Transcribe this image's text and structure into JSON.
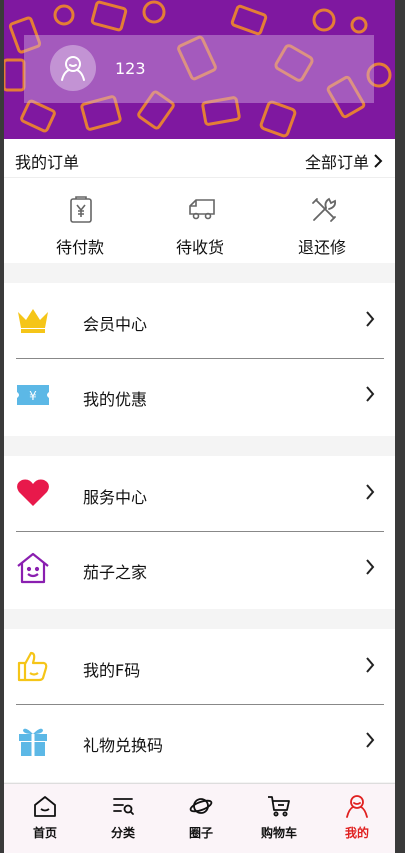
{
  "colors": {
    "banner": "#7f18a0",
    "pattern": "#f08a2a",
    "accent_red": "#e02020",
    "crown": "#f5c518",
    "ticket": "#5cb8e6",
    "heart": "#e8194b",
    "home_purple": "#8a1fb0",
    "thumb": "#f5c518"
  },
  "profile": {
    "avatar_icon": "user-face-icon",
    "username": "123"
  },
  "orders": {
    "title": "我的订单",
    "all_label": "全部订单",
    "items": [
      {
        "label": "待付款",
        "icon": "yen-receipt-icon"
      },
      {
        "label": "待收货",
        "icon": "truck-icon"
      },
      {
        "label": "退还修",
        "icon": "tools-icon"
      }
    ]
  },
  "menu": {
    "group1": [
      {
        "label": "会员中心",
        "icon": "crown-icon"
      },
      {
        "label": "我的优惠",
        "icon": "ticket-icon"
      }
    ],
    "group2": [
      {
        "label": "服务中心",
        "icon": "heart-icon"
      },
      {
        "label": "茄子之家",
        "icon": "home-smile-icon"
      }
    ],
    "group3": [
      {
        "label": "我的F码",
        "icon": "thumbs-up-icon"
      },
      {
        "label": "礼物兑换码",
        "icon": "gift-icon"
      }
    ]
  },
  "tabbar": {
    "items": [
      {
        "label": "首页",
        "icon": "home-icon"
      },
      {
        "label": "分类",
        "icon": "category-icon"
      },
      {
        "label": "圈子",
        "icon": "planet-icon"
      },
      {
        "label": "购物车",
        "icon": "cart-icon"
      },
      {
        "label": "我的",
        "icon": "user-icon",
        "active": true
      }
    ]
  }
}
